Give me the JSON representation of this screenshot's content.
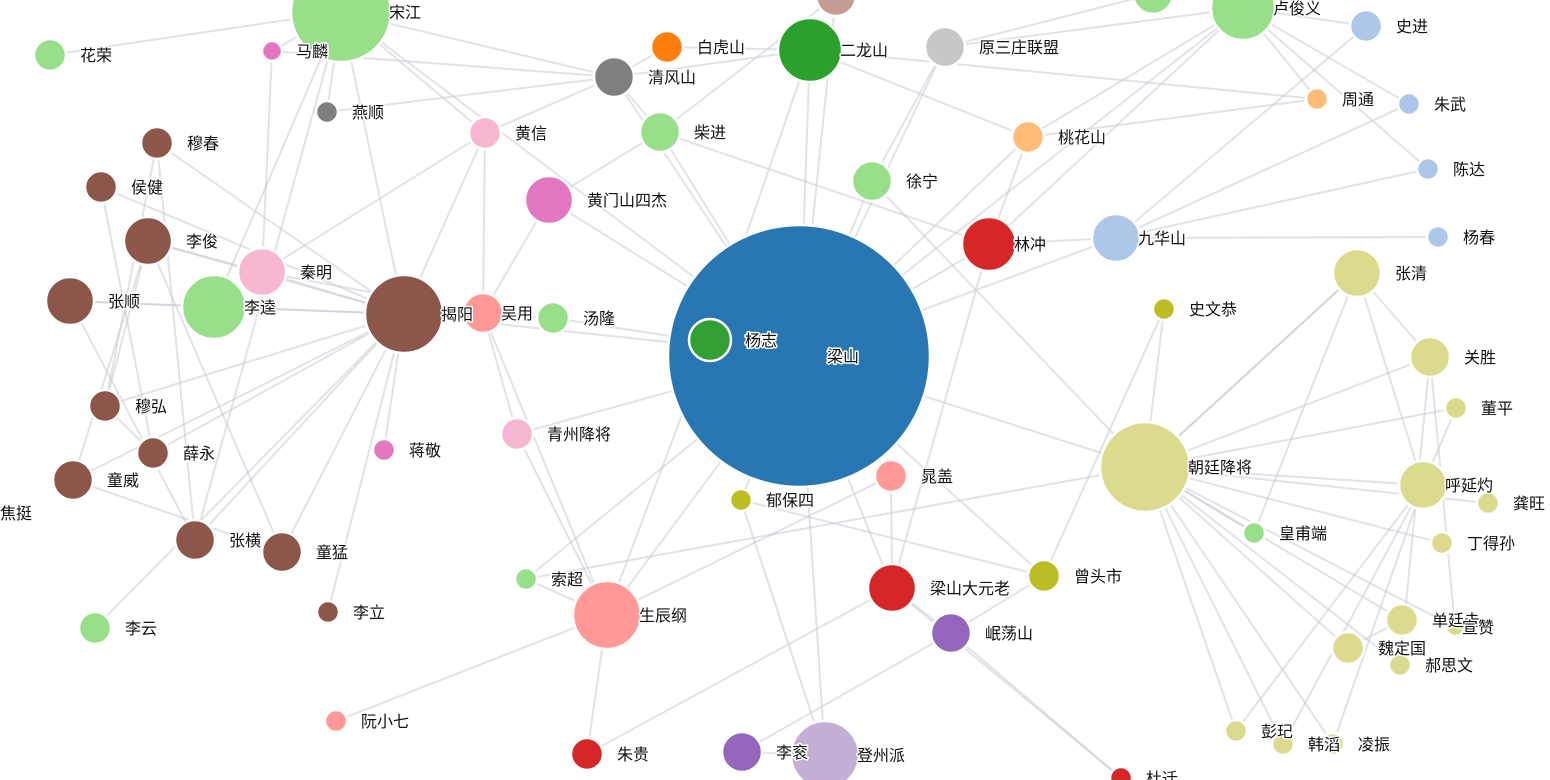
{
  "chart_data": {
    "type": "network",
    "nodes": [
      {
        "id": "liangshan",
        "label": "梁山",
        "color": "#2877b3"
      },
      {
        "id": "yangzhi",
        "label": "杨志",
        "color": "#34a033"
      },
      {
        "id": "songjiang",
        "label": "宋江",
        "color": "#98df8a"
      },
      {
        "id": "lujunyi",
        "label": "卢俊义",
        "color": "#98df8a"
      },
      {
        "id": "huarong",
        "label": "花荣",
        "color": "#98df8a"
      },
      {
        "id": "malin",
        "label": "马麟",
        "color": "#e377c2"
      },
      {
        "id": "baihushan",
        "label": "白虎山",
        "color": "#ff7f0e"
      },
      {
        "id": "qingfengshan",
        "label": "清风山",
        "color": "#7f7f7f"
      },
      {
        "id": "erlongshan",
        "label": "二龙山",
        "color": "#2ca02c"
      },
      {
        "id": "yuansanzhuang",
        "label": "原三庄联盟",
        "color": "#c7c7c7"
      },
      {
        "id": "shijin",
        "label": "史进",
        "color": "#aec7e8"
      },
      {
        "id": "zhoutong",
        "label": "周通",
        "color": "#ffbb78"
      },
      {
        "id": "zhuwu",
        "label": "朱武",
        "color": "#aec7e8"
      },
      {
        "id": "yanshun",
        "label": "燕顺",
        "color": "#7f7f7f"
      },
      {
        "id": "huangxin",
        "label": "黄信",
        "color": "#f7b6d2"
      },
      {
        "id": "chaijin",
        "label": "柴进",
        "color": "#98df8a"
      },
      {
        "id": "taohuashan",
        "label": "桃花山",
        "color": "#ffbb78"
      },
      {
        "id": "muchun",
        "label": "穆春",
        "color": "#8c564b"
      },
      {
        "id": "houjian",
        "label": "侯健",
        "color": "#8c564b"
      },
      {
        "id": "chenda",
        "label": "陈达",
        "color": "#aec7e8"
      },
      {
        "id": "huangmen",
        "label": "黄门山四杰",
        "color": "#e377c2"
      },
      {
        "id": "xuning",
        "label": "徐宁",
        "color": "#98df8a"
      },
      {
        "id": "lijun",
        "label": "李俊",
        "color": "#8c564b"
      },
      {
        "id": "linchong",
        "label": "林冲",
        "color": "#d62728"
      },
      {
        "id": "jiuhuashan",
        "label": "九华山",
        "color": "#aec7e8"
      },
      {
        "id": "yangchun",
        "label": "杨春",
        "color": "#aec7e8"
      },
      {
        "id": "qinming",
        "label": "秦明",
        "color": "#f7b6d2"
      },
      {
        "id": "zhangqing",
        "label": "张清",
        "color": "#dbdb8d"
      },
      {
        "id": "zhangshun",
        "label": "张顺",
        "color": "#8c564b"
      },
      {
        "id": "likui",
        "label": "李逵",
        "color": "#98df8a"
      },
      {
        "id": "jieyang",
        "label": "揭阳",
        "color": "#8c564b"
      },
      {
        "id": "wuyong",
        "label": "吴用",
        "color": "#ff9896"
      },
      {
        "id": "tanglong",
        "label": "汤隆",
        "color": "#98df8a"
      },
      {
        "id": "shiwengong",
        "label": "史文恭",
        "color": "#bcbd22"
      },
      {
        "id": "guansheng",
        "label": "关胜",
        "color": "#dbdb8d"
      },
      {
        "id": "muhong",
        "label": "穆弘",
        "color": "#8c564b"
      },
      {
        "id": "dongping",
        "label": "董平",
        "color": "#dbdb8d"
      },
      {
        "id": "qingzhou",
        "label": "青州降将",
        "color": "#f7b6d2"
      },
      {
        "id": "xueyong",
        "label": "薛永",
        "color": "#8c564b"
      },
      {
        "id": "jiangjing",
        "label": "蒋敬",
        "color": "#e377c2"
      },
      {
        "id": "tongwei",
        "label": "童威",
        "color": "#8c564b"
      },
      {
        "id": "chaogai",
        "label": "晁盖",
        "color": "#ff9896"
      },
      {
        "id": "chaoting",
        "label": "朝廷降将",
        "color": "#dbdb8d"
      },
      {
        "id": "yubaosi",
        "label": "郁保四",
        "color": "#bcbd22"
      },
      {
        "id": "huyanzhuo",
        "label": "呼延灼",
        "color": "#dbdb8d"
      },
      {
        "id": "gongwang",
        "label": "龚旺",
        "color": "#dbdb8d"
      },
      {
        "id": "jiaoting",
        "label": "焦挺",
        "color": "#8c564b"
      },
      {
        "id": "huangfuduan",
        "label": "皇甫端",
        "color": "#98df8a"
      },
      {
        "id": "dingdesun",
        "label": "丁得孙",
        "color": "#dbdb8d"
      },
      {
        "id": "zhangheng",
        "label": "张横",
        "color": "#8c564b"
      },
      {
        "id": "tongmeng",
        "label": "童猛",
        "color": "#8c564b"
      },
      {
        "id": "suochao",
        "label": "索超",
        "color": "#98df8a"
      },
      {
        "id": "shengchengang",
        "label": "生辰纲",
        "color": "#ff9896"
      },
      {
        "id": "liangshandayuanlao",
        "label": "梁山大元老",
        "color": "#d62728"
      },
      {
        "id": "zengtoushi",
        "label": "曾头市",
        "color": "#bcbd22"
      },
      {
        "id": "danting",
        "label": "单廷圭",
        "color": "#dbdb8d"
      },
      {
        "id": "xuanzan",
        "label": "宣赞",
        "color": "#dbdb8d"
      },
      {
        "id": "lili",
        "label": "李立",
        "color": "#8c564b"
      },
      {
        "id": "liyun",
        "label": "李云",
        "color": "#98df8a"
      },
      {
        "id": "mindangshan",
        "label": "岷荡山",
        "color": "#9467bd"
      },
      {
        "id": "weidingguo",
        "label": "魏定国",
        "color": "#dbdb8d"
      },
      {
        "id": "haosiwen",
        "label": "郝思文",
        "color": "#dbdb8d"
      },
      {
        "id": "ruanxiaoqi",
        "label": "阮小七",
        "color": "#ff9896"
      },
      {
        "id": "pengqi",
        "label": "彭玘",
        "color": "#dbdb8d"
      },
      {
        "id": "hanchao",
        "label": "韩滔",
        "color": "#dbdb8d"
      },
      {
        "id": "lingzhen",
        "label": "凌振",
        "color": "#dbdb8d"
      },
      {
        "id": "zhugui",
        "label": "朱贵",
        "color": "#d62728"
      },
      {
        "id": "ligun",
        "label": "李衮",
        "color": "#9467bd"
      },
      {
        "id": "dengzhou",
        "label": "登州派",
        "color": "#c5b0d5"
      },
      {
        "id": "duqian",
        "label": "杜迁",
        "color": "#d62728"
      },
      {
        "id": "topnode",
        "label": "",
        "color": "#c49c94"
      },
      {
        "id": "topgreen",
        "label": "",
        "color": "#98df8a"
      }
    ],
    "edges": [
      [
        "liangshan",
        "yangzhi"
      ],
      [
        "liangshan",
        "erlongshan"
      ],
      [
        "liangshan",
        "chaijin"
      ],
      [
        "liangshan",
        "xuning"
      ],
      [
        "liangshan",
        "linchong"
      ],
      [
        "liangshan",
        "jiuhuashan"
      ],
      [
        "liangshan",
        "huangmen"
      ],
      [
        "liangshan",
        "tanglong"
      ],
      [
        "liangshan",
        "jieyang"
      ],
      [
        "liangshan",
        "qingzhou"
      ],
      [
        "liangshan",
        "chaogai"
      ],
      [
        "liangshan",
        "yubaosi"
      ],
      [
        "liangshan",
        "chaoting"
      ],
      [
        "liangshan",
        "shengchengang"
      ],
      [
        "liangshan",
        "liangshandayuanlao"
      ],
      [
        "liangshan",
        "zengtoushi"
      ],
      [
        "liangshan",
        "dengzhou"
      ],
      [
        "liangshan",
        "songjiang"
      ],
      [
        "liangshan",
        "lujunyi"
      ],
      [
        "liangshan",
        "yuansanzhuang"
      ],
      [
        "liangshan",
        "taohuashan"
      ],
      [
        "liangshan",
        "topnode"
      ],
      [
        "liangshan",
        "qingfengshan"
      ],
      [
        "liangshan",
        "suochao"
      ],
      [
        "jieyang",
        "lijun"
      ],
      [
        "jieyang",
        "zhangshun"
      ],
      [
        "jieyang",
        "likui"
      ],
      [
        "jieyang",
        "muhong"
      ],
      [
        "jieyang",
        "xueyong"
      ],
      [
        "jieyang",
        "tongwei"
      ],
      [
        "jieyang",
        "zhangheng"
      ],
      [
        "jieyang",
        "tongmeng"
      ],
      [
        "jieyang",
        "muchun"
      ],
      [
        "jieyang",
        "houjian"
      ],
      [
        "jieyang",
        "songjiang"
      ],
      [
        "jieyang",
        "jiangjing"
      ],
      [
        "jieyang",
        "lili"
      ],
      [
        "jieyang",
        "qinming"
      ],
      [
        "jieyang",
        "wuyong"
      ],
      [
        "jieyang",
        "huangxin"
      ],
      [
        "jieyang",
        "liyun"
      ],
      [
        "songjiang",
        "huarong"
      ],
      [
        "songjiang",
        "malin"
      ],
      [
        "songjiang",
        "qingfengshan"
      ],
      [
        "songjiang",
        "yanshun"
      ],
      [
        "songjiang",
        "likui"
      ],
      [
        "songjiang",
        "zhangheng"
      ],
      [
        "songjiang",
        "huangxin"
      ],
      [
        "qingfengshan",
        "huangxin"
      ],
      [
        "qingfengshan",
        "yanshun"
      ],
      [
        "qingfengshan",
        "malin"
      ],
      [
        "qingfengshan",
        "erlongshan"
      ],
      [
        "baihushan",
        "qingfengshan"
      ],
      [
        "baihushan",
        "erlongshan"
      ],
      [
        "erlongshan",
        "yangzhi"
      ],
      [
        "erlongshan",
        "zhoutong"
      ],
      [
        "erlongshan",
        "taohuashan"
      ],
      [
        "lujunyi",
        "shijin"
      ],
      [
        "lujunyi",
        "zhuwu"
      ],
      [
        "lujunyi",
        "chenda"
      ],
      [
        "lujunyi",
        "zhoutong"
      ],
      [
        "lujunyi",
        "taohuashan"
      ],
      [
        "lujunyi",
        "yuansanzhuang"
      ],
      [
        "lujunyi",
        "linchong"
      ],
      [
        "taohuashan",
        "zhoutong"
      ],
      [
        "taohuashan",
        "linchong"
      ],
      [
        "jiuhuashan",
        "yangchun"
      ],
      [
        "jiuhuashan",
        "chenda"
      ],
      [
        "jiuhuashan",
        "shijin"
      ],
      [
        "jiuhuashan",
        "zhuwu"
      ],
      [
        "jiuhuashan",
        "linchong"
      ],
      [
        "linchong",
        "chaijin"
      ],
      [
        "linchong",
        "liangshandayuanlao"
      ],
      [
        "chaoting",
        "guansheng"
      ],
      [
        "chaoting",
        "dongping"
      ],
      [
        "chaoting",
        "huyanzhuo"
      ],
      [
        "chaoting",
        "gongwang"
      ],
      [
        "chaoting",
        "huangfuduan"
      ],
      [
        "chaoting",
        "dingdesun"
      ],
      [
        "chaoting",
        "danting"
      ],
      [
        "chaoting",
        "xuanzan"
      ],
      [
        "chaoting",
        "weidingguo"
      ],
      [
        "chaoting",
        "haosiwen"
      ],
      [
        "chaoting",
        "pengqi"
      ],
      [
        "chaoting",
        "hanchao"
      ],
      [
        "chaoting",
        "lingzhen"
      ],
      [
        "chaoting",
        "zhangqing"
      ],
      [
        "chaoting",
        "zhangqing"
      ],
      [
        "chaoting",
        "xuning"
      ],
      [
        "chaoting",
        "suochao"
      ],
      [
        "zhangqing",
        "guansheng"
      ],
      [
        "zhangqing",
        "huyanzhuo"
      ],
      [
        "zhangqing",
        "huangfuduan"
      ],
      [
        "guansheng",
        "xuanzan"
      ],
      [
        "guansheng",
        "haosiwen"
      ],
      [
        "huyanzhuo",
        "pengqi"
      ],
      [
        "huyanzhuo",
        "hanchao"
      ],
      [
        "huyanzhuo",
        "lingzhen"
      ],
      [
        "huyanzhuo",
        "dongping"
      ],
      [
        "weidingguo",
        "danting"
      ],
      [
        "shengchengang",
        "yangzhi"
      ],
      [
        "shengchengang",
        "wuyong"
      ],
      [
        "shengchengang",
        "chaogai"
      ],
      [
        "shengchengang",
        "ruanxiaoqi"
      ],
      [
        "shengchengang",
        "zhugui"
      ],
      [
        "shengchengang",
        "suochao"
      ],
      [
        "shengchengang",
        "qingzhou"
      ],
      [
        "liangshandayuanlao",
        "chaogai"
      ],
      [
        "liangshandayuanlao",
        "zhugui"
      ],
      [
        "liangshandayuanlao",
        "duqian"
      ],
      [
        "mindangshan",
        "ligun"
      ],
      [
        "mindangshan",
        "zengtoushi"
      ],
      [
        "mindangshan",
        "duqian"
      ],
      [
        "mindangshan",
        "liangshandayuanlao"
      ],
      [
        "zengtoushi",
        "shiwengong"
      ],
      [
        "zengtoushi",
        "yubaosi"
      ],
      [
        "dengzhou",
        "ligun"
      ],
      [
        "dengzhou",
        "yubaosi"
      ],
      [
        "wuyong",
        "tanglong"
      ],
      [
        "wuyong",
        "huangmen"
      ],
      [
        "wuyong",
        "qingzhou"
      ],
      [
        "wuyong",
        "qinming"
      ],
      [
        "wuyong",
        "huangxin"
      ],
      [
        "qinming",
        "lijun"
      ],
      [
        "qinming",
        "malin"
      ],
      [
        "qinming",
        "huangxin"
      ],
      [
        "zhangshun",
        "likui"
      ],
      [
        "zhangshun",
        "zhangheng"
      ],
      [
        "lijun",
        "tongwei"
      ],
      [
        "lijun",
        "tongmeng"
      ],
      [
        "lijun",
        "muhong"
      ],
      [
        "muhong",
        "muchun"
      ],
      [
        "muhong",
        "xueyong"
      ],
      [
        "houjian",
        "xueyong"
      ],
      [
        "tongwei",
        "tongmeng"
      ],
      [
        "zhangheng",
        "muchun"
      ],
      [
        "chaijin",
        "huangmen"
      ],
      [
        "chaijin",
        "topnode"
      ],
      [
        "chaijin",
        "qingfengshan"
      ],
      [
        "xuning",
        "yuansanzhuang"
      ],
      [
        "yuansanzhuang",
        "topgreen"
      ],
      [
        "shiwengong",
        "chaoting"
      ]
    ]
  }
}
